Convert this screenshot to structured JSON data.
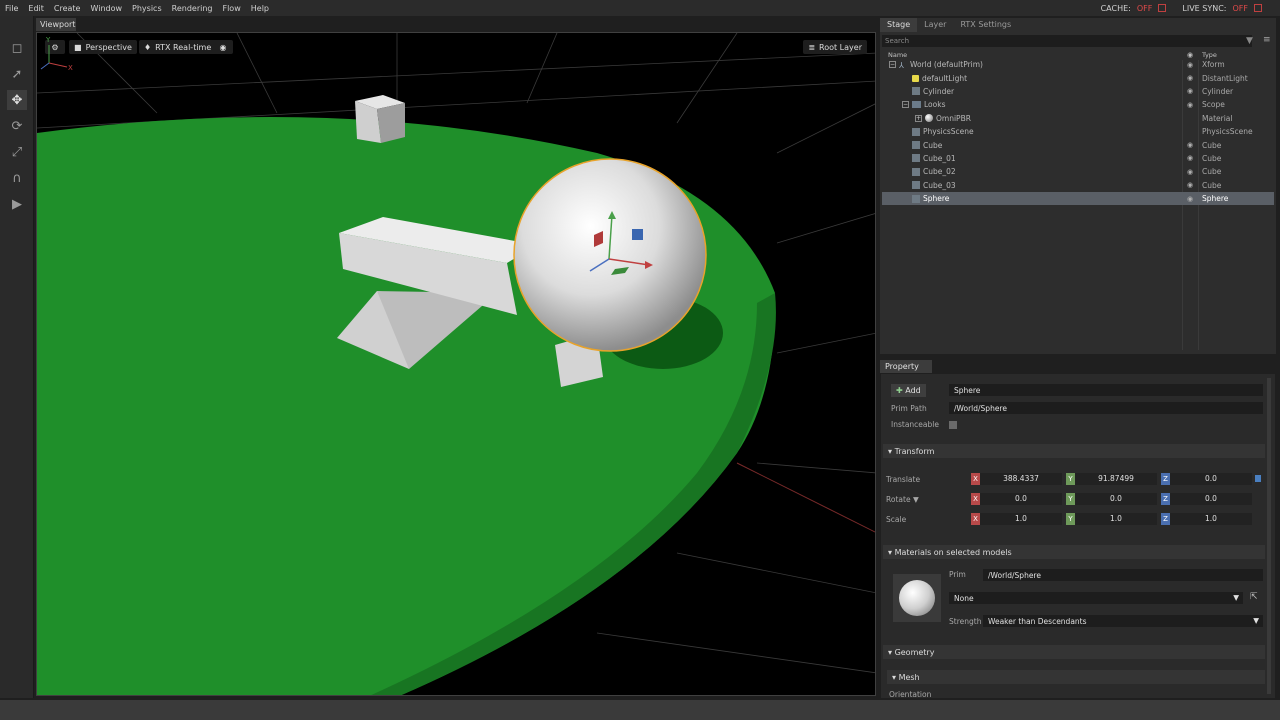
{
  "menu": [
    "File",
    "Edit",
    "Create",
    "Window",
    "Physics",
    "Rendering",
    "Flow",
    "Help"
  ],
  "status": {
    "cache_label": "CACHE:",
    "cache_value": "OFF",
    "livesync_label": "LIVE SYNC:",
    "livesync_value": "OFF"
  },
  "viewport": {
    "tab": "Viewport",
    "camera": "Perspective",
    "renderer": "RTX Real-time",
    "layer": "Root Layer",
    "axis_y": "Y",
    "axis_x": "X",
    "axis_z": "Z"
  },
  "stage": {
    "tabs": [
      "Stage",
      "Layer",
      "RTX Settings"
    ],
    "search_placeholder": "Search",
    "col_name": "Name",
    "col_type": "Type",
    "rows": [
      {
        "name": "World (defaultPrim)",
        "type": "Xform",
        "indent": 1,
        "icon": "xform-icon",
        "expand": "minus",
        "eye": true
      },
      {
        "name": "defaultLight",
        "type": "DistantLight",
        "indent": 2,
        "icon": "light-icon",
        "eye": true
      },
      {
        "name": "Cylinder",
        "type": "Cylinder",
        "indent": 2,
        "icon": "mesh-icon",
        "eye": true
      },
      {
        "name": "Looks",
        "type": "Scope",
        "indent": 2,
        "icon": "folder-icon",
        "expand": "minus",
        "eye": true
      },
      {
        "name": "OmniPBR",
        "type": "Material",
        "indent": 3,
        "icon": "material-icon",
        "expand": "plus",
        "eye": false
      },
      {
        "name": "PhysicsScene",
        "type": "PhysicsScene",
        "indent": 2,
        "icon": "mesh-icon",
        "eye": false
      },
      {
        "name": "Cube",
        "type": "Cube",
        "indent": 2,
        "icon": "mesh-icon",
        "eye": true
      },
      {
        "name": "Cube_01",
        "type": "Cube",
        "indent": 2,
        "icon": "mesh-icon",
        "eye": true
      },
      {
        "name": "Cube_02",
        "type": "Cube",
        "indent": 2,
        "icon": "mesh-icon",
        "eye": true
      },
      {
        "name": "Cube_03",
        "type": "Cube",
        "indent": 2,
        "icon": "mesh-icon",
        "eye": true
      },
      {
        "name": "Sphere",
        "type": "Sphere",
        "indent": 2,
        "icon": "mesh-icon",
        "eye": true,
        "selected": true
      }
    ]
  },
  "property": {
    "tab": "Property",
    "add_label": "Add",
    "prim_name": "Sphere",
    "prim_path_label": "Prim Path",
    "prim_path": "/World/Sphere",
    "instanceable_label": "Instanceable",
    "transform_title": "Transform",
    "translate_label": "Translate",
    "rotate_label": "Rotate",
    "scale_label": "Scale",
    "translate": {
      "x": "388.4337",
      "y": "91.87499",
      "z": "0.0"
    },
    "rotate": {
      "x": "0.0",
      "y": "0.0",
      "z": "0.0"
    },
    "scale": {
      "x": "1.0",
      "y": "1.0",
      "z": "1.0"
    },
    "materials_title": "Materials on selected models",
    "mat_prim_label": "Prim",
    "mat_prim": "/World/Sphere",
    "mat_binding": "None",
    "strength_label": "Strength",
    "strength_value": "Weaker than Descendants",
    "geometry_title": "Geometry",
    "mesh_title": "Mesh",
    "orientation_label": "Orientation"
  },
  "colors": {
    "ground": "#1f8f2a",
    "selection_outline": "#e8a32a",
    "panel_bg": "#2d2d2d",
    "selected_row": "#5a5f66"
  }
}
